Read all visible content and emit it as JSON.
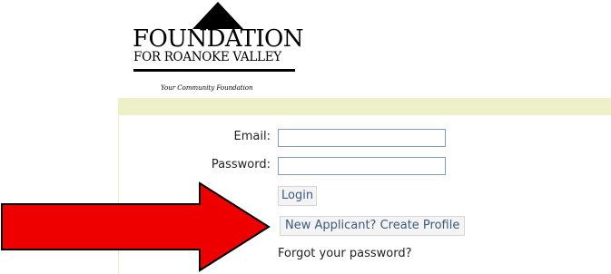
{
  "logo": {
    "name": "FOUNDATION",
    "subname": "FOR ROANOKE VALLEY",
    "tagline": "Your Community Foundation"
  },
  "login": {
    "email_label": "Email:",
    "email_value": "",
    "password_label": "Password:",
    "password_value": "",
    "login_button": "Login",
    "create_profile_button": "New Applicant? Create Profile",
    "forgot_link": "Forgot your password?"
  },
  "colors": {
    "band": "#eef0c8",
    "arrow": "#ee0000",
    "button_text": "#3a5a7d",
    "field_border": "#7f9db9"
  },
  "annotation": {
    "arrow_icon": "red-arrow-right-icon"
  }
}
